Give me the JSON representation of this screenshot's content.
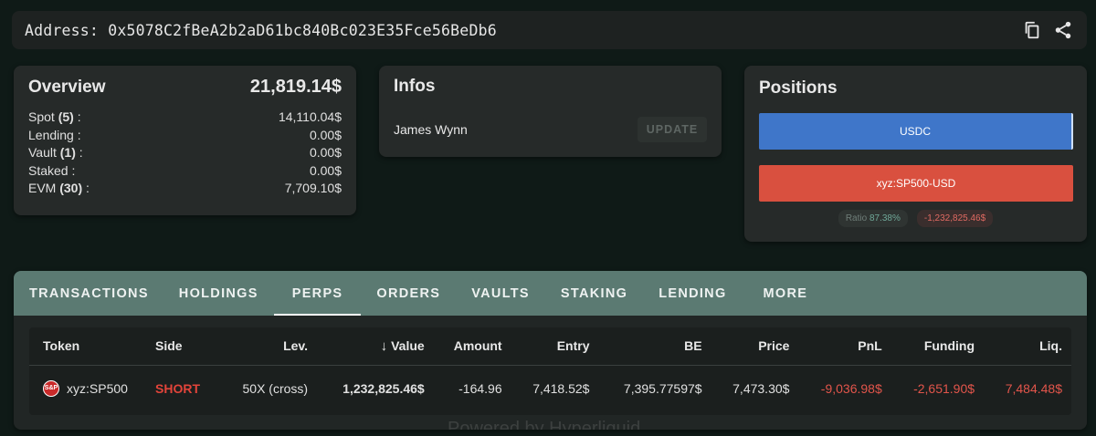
{
  "address": {
    "label": "Address:",
    "value": "0x5078C2fBeA2b2aD61bc840Bc023E35Fce56BeDb6"
  },
  "overview": {
    "title": "Overview",
    "total": "21,819.14$",
    "rows": [
      {
        "label": "Spot",
        "count": "(5)",
        "suffix": ":",
        "value": "14,110.04$"
      },
      {
        "label": "Lending",
        "count": "",
        "suffix": ":",
        "value": "0.00$"
      },
      {
        "label": "Vault",
        "count": "(1)",
        "suffix": ":",
        "value": "0.00$"
      },
      {
        "label": "Staked",
        "count": "",
        "suffix": ":",
        "value": "0.00$"
      },
      {
        "label": "EVM",
        "count": "(30)",
        "suffix": ":",
        "value": "7,709.10$"
      }
    ]
  },
  "infos": {
    "title": "Infos",
    "name": "James Wynn",
    "update_label": "UPDATE"
  },
  "positions": {
    "title": "Positions",
    "bars": [
      {
        "label": "USDC",
        "color": "#3f76c9"
      },
      {
        "label": "xyz:SP500-USD",
        "color": "#d9503f"
      }
    ],
    "ratio_label": "Ratio",
    "ratio_value": "87.38%",
    "pnl_badge": "-1,232,825.46$"
  },
  "tabs": [
    "TRANSACTIONS",
    "HOLDINGS",
    "PERPS",
    "ORDERS",
    "VAULTS",
    "STAKING",
    "LENDING",
    "MORE"
  ],
  "active_tab": "PERPS",
  "table": {
    "headers": [
      "Token",
      "Side",
      "Lev.",
      "Value",
      "Amount",
      "Entry",
      "BE",
      "Price",
      "PnL",
      "Funding",
      "Liq."
    ],
    "rows": [
      {
        "token_icon": "S&P",
        "token": "xyz:SP500",
        "side": "SHORT",
        "lev": "50X (cross)",
        "value": "1,232,825.46$",
        "amount": "-164.96",
        "entry": "7,418.52$",
        "be": "7,395.77597$",
        "price": "7,473.30$",
        "pnl": "-9,036.98$",
        "funding": "-2,651.90$",
        "liq": "7,484.48$"
      }
    ]
  },
  "watermark": "Powered by Hyperliquid"
}
